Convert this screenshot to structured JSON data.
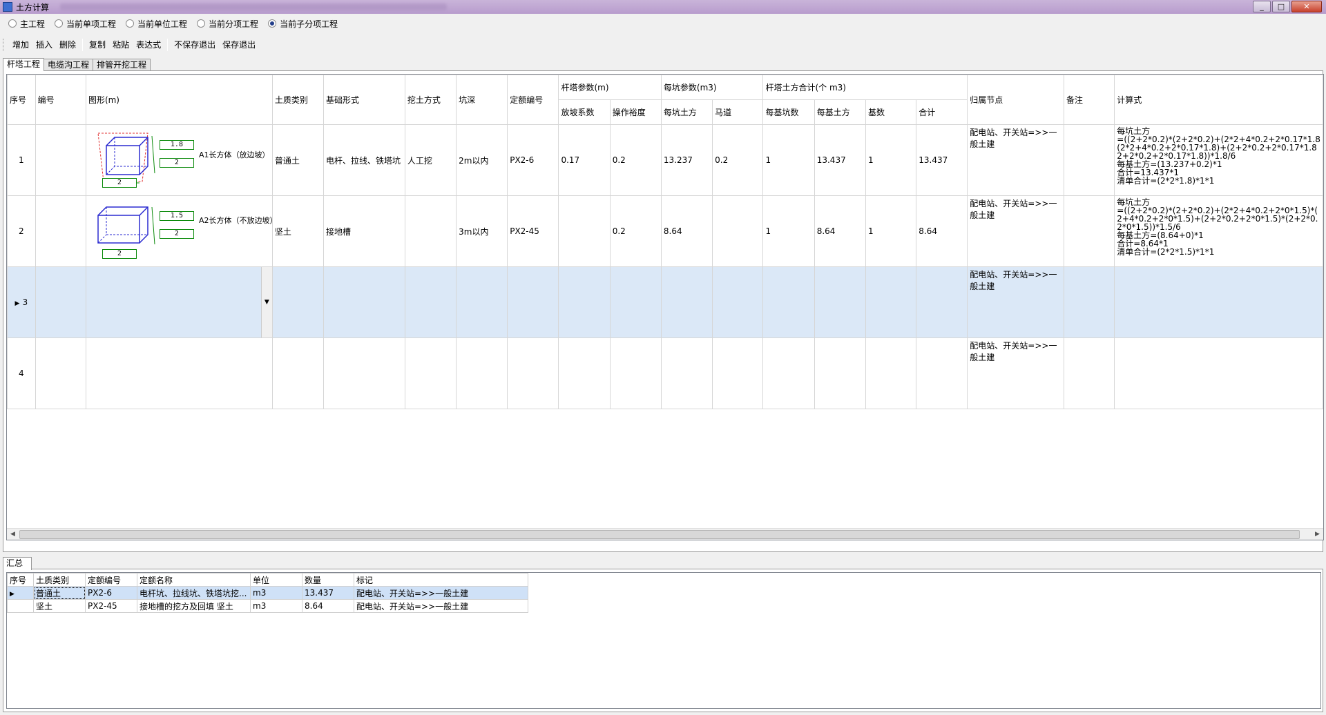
{
  "window": {
    "title": "土方计算"
  },
  "radios": [
    {
      "label": "主工程",
      "checked": false
    },
    {
      "label": "当前单项工程",
      "checked": false
    },
    {
      "label": "当前单位工程",
      "checked": false
    },
    {
      "label": "当前分项工程",
      "checked": false
    },
    {
      "label": "当前子分项工程",
      "checked": true
    }
  ],
  "toolbar": {
    "add": "增加",
    "insert": "插入",
    "delete": "删除",
    "copy": "复制",
    "paste": "粘贴",
    "expression": "表达式",
    "exit_nosave": "不保存退出",
    "save_exit": "保存退出"
  },
  "tabs": [
    "杆塔工程",
    "电缆沟工程",
    "排管开挖工程"
  ],
  "grid": {
    "headers": {
      "seq": "序号",
      "code": "编号",
      "shape": "图形(m)",
      "soil": "土质类别",
      "foundation": "基础形式",
      "dig": "挖土方式",
      "depth": "坑深",
      "quota": "定额编号",
      "tower_params": "杆塔参数(m)",
      "slope": "放坡系数",
      "margin": "操作裕度",
      "pit_params": "每坑参数(m3)",
      "pit_earth": "每坑土方",
      "ramp": "马道",
      "tower_total": "杆塔土方合计(个 m3)",
      "per_pit_count": "每基坑数",
      "per_base_earth": "每基土方",
      "base_count": "基数",
      "total": "合计",
      "node": "归属节点",
      "note": "备注",
      "formula": "计算式"
    },
    "rows": [
      {
        "seq": "1",
        "code": "",
        "soil": "普通土",
        "foundation": "电杆、拉线、铁塔坑",
        "dig": "人工挖",
        "depth": "2m以内",
        "quota": "PX2-6",
        "slope": "0.17",
        "margin": "0.2",
        "pit_earth": "13.237",
        "ramp": "0.2",
        "per_pit_count": "1",
        "per_base_earth": "13.437",
        "base_count": "1",
        "total": "13.437",
        "node": "配电站、开关站=>>一般土建",
        "note": "",
        "shape": {
          "h": "1.8",
          "w": "2",
          "b": "2",
          "label": "A1长方体（放边坡）"
        },
        "formula": [
          "每坑土方",
          "=((2+2*0.2)*(2+2*0.2)+(2*2+4*0.2+2*0.17*1.8",
          "(2*2+4*0.2+2*0.17*1.8)+(2+2*0.2+2*0.17*1.8",
          "2+2*0.2+2*0.17*1.8))*1.8/6",
          "每基土方=(13.237+0.2)*1",
          "合计=13.437*1",
          "清单合计=(2*2*1.8)*1*1"
        ]
      },
      {
        "seq": "2",
        "code": "",
        "soil": "坚土",
        "foundation": "接地槽",
        "dig": "",
        "depth": "3m以内",
        "quota": "PX2-45",
        "slope": "",
        "margin": "0.2",
        "pit_earth": "8.64",
        "ramp": "",
        "per_pit_count": "1",
        "per_base_earth": "8.64",
        "base_count": "1",
        "total": "8.64",
        "node": "配电站、开关站=>>一般土建",
        "note": "",
        "shape": {
          "h": "1.5",
          "w": "2",
          "b": "2",
          "label": "A2长方体（不放边坡）"
        },
        "formula": [
          "每坑土方",
          "=((2+2*0.2)*(2+2*0.2)+(2*2+4*0.2+2*0*1.5)*(",
          "2+4*0.2+2*0*1.5)+(2+2*0.2+2*0*1.5)*(2+2*0.",
          "2*0*1.5))*1.5/6",
          "每基土方=(8.64+0)*1",
          "合计=8.64*1",
          "清单合计=(2*2*1.5)*1*1"
        ]
      },
      {
        "seq": "3",
        "node": "配电站、开关站=>>一般土建"
      },
      {
        "seq": "4",
        "node": "配电站、开关站=>>一般土建"
      }
    ]
  },
  "summary": {
    "tab": "汇总",
    "headers": [
      "序号",
      "土质类别",
      "定额编号",
      "定额名称",
      "单位",
      "数量",
      "标记"
    ],
    "rows": [
      [
        "",
        "普通土",
        "PX2-6",
        "电杆坑、拉线坑、铁塔坑挖...",
        "m3",
        "13.437",
        "配电站、开关站=>>一般土建"
      ],
      [
        "",
        "坚土",
        "PX2-45",
        "接地槽的挖方及回填 坚土",
        "m3",
        "8.64",
        "配电站、开关站=>>一般土建"
      ]
    ]
  }
}
